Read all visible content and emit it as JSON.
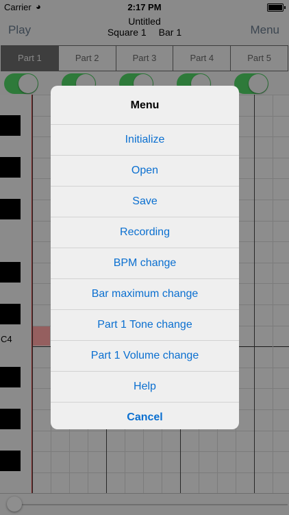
{
  "status": {
    "carrier": "Carrier",
    "wifi": "wifi-icon",
    "time": "2:17 PM",
    "battery": "battery-icon"
  },
  "nav": {
    "play": "Play",
    "title": "Untitled",
    "sound": "Square 1",
    "bar": "Bar 1",
    "menu": "Menu"
  },
  "tabs": [
    {
      "label": "Part 1",
      "active": true
    },
    {
      "label": "Part 2",
      "active": false
    },
    {
      "label": "Part 3",
      "active": false
    },
    {
      "label": "Part 4",
      "active": false
    },
    {
      "label": "Part 5",
      "active": false
    }
  ],
  "toggles": [
    {
      "on": true
    },
    {
      "on": true
    },
    {
      "on": true
    },
    {
      "on": true
    },
    {
      "on": true
    }
  ],
  "roll": {
    "note_label": "C4",
    "accent_color": "#955f5f"
  },
  "slider": {
    "value": 0
  },
  "menu": {
    "title": "Menu",
    "items": [
      "Initialize",
      "Open",
      "Save",
      "Recording",
      "BPM change",
      "Bar maximum change",
      "Part 1 Tone change",
      "Part 1 Volume change",
      "Help"
    ],
    "cancel": "Cancel",
    "link_color": "#0a6fd0"
  }
}
